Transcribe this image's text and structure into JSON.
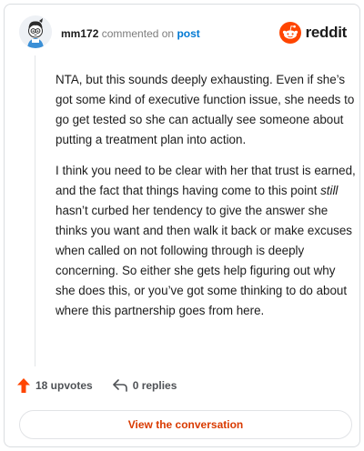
{
  "header": {
    "username": "mm172",
    "commented_text": "commented on",
    "post_link": "post",
    "brand_name": "reddit",
    "avatar_icon": "cartoon-avatar-icon",
    "brand_icon": "reddit-snoo-icon"
  },
  "comment": {
    "paragraph1": "NTA, but this sounds deeply exhausting. Even if she’s got some kind of executive function issue, she needs to go get tested so she can actually see someone about putting a treatment plan into action.",
    "paragraph2_before": "I think you need to be clear with her that trust is earned, and the fact that things having come to this point ",
    "paragraph2_emphasis": "still",
    "paragraph2_after": " hasn’t curbed her tendency to give the answer she thinks you want and then walk it back or make excuses when called on not following through is deeply concerning. So either she gets help figuring out why she does this, or you’ve got some thinking to do about where this partnership goes from here."
  },
  "footer": {
    "upvotes": "18 upvotes",
    "replies": "0 replies",
    "upvote_icon": "upvote-arrow-icon",
    "reply_icon": "reply-arrow-icon"
  },
  "cta": {
    "label": "View the conversation"
  },
  "colors": {
    "brand": "#ff4500",
    "link": "#0079d3",
    "cta_text": "#d93a00"
  }
}
